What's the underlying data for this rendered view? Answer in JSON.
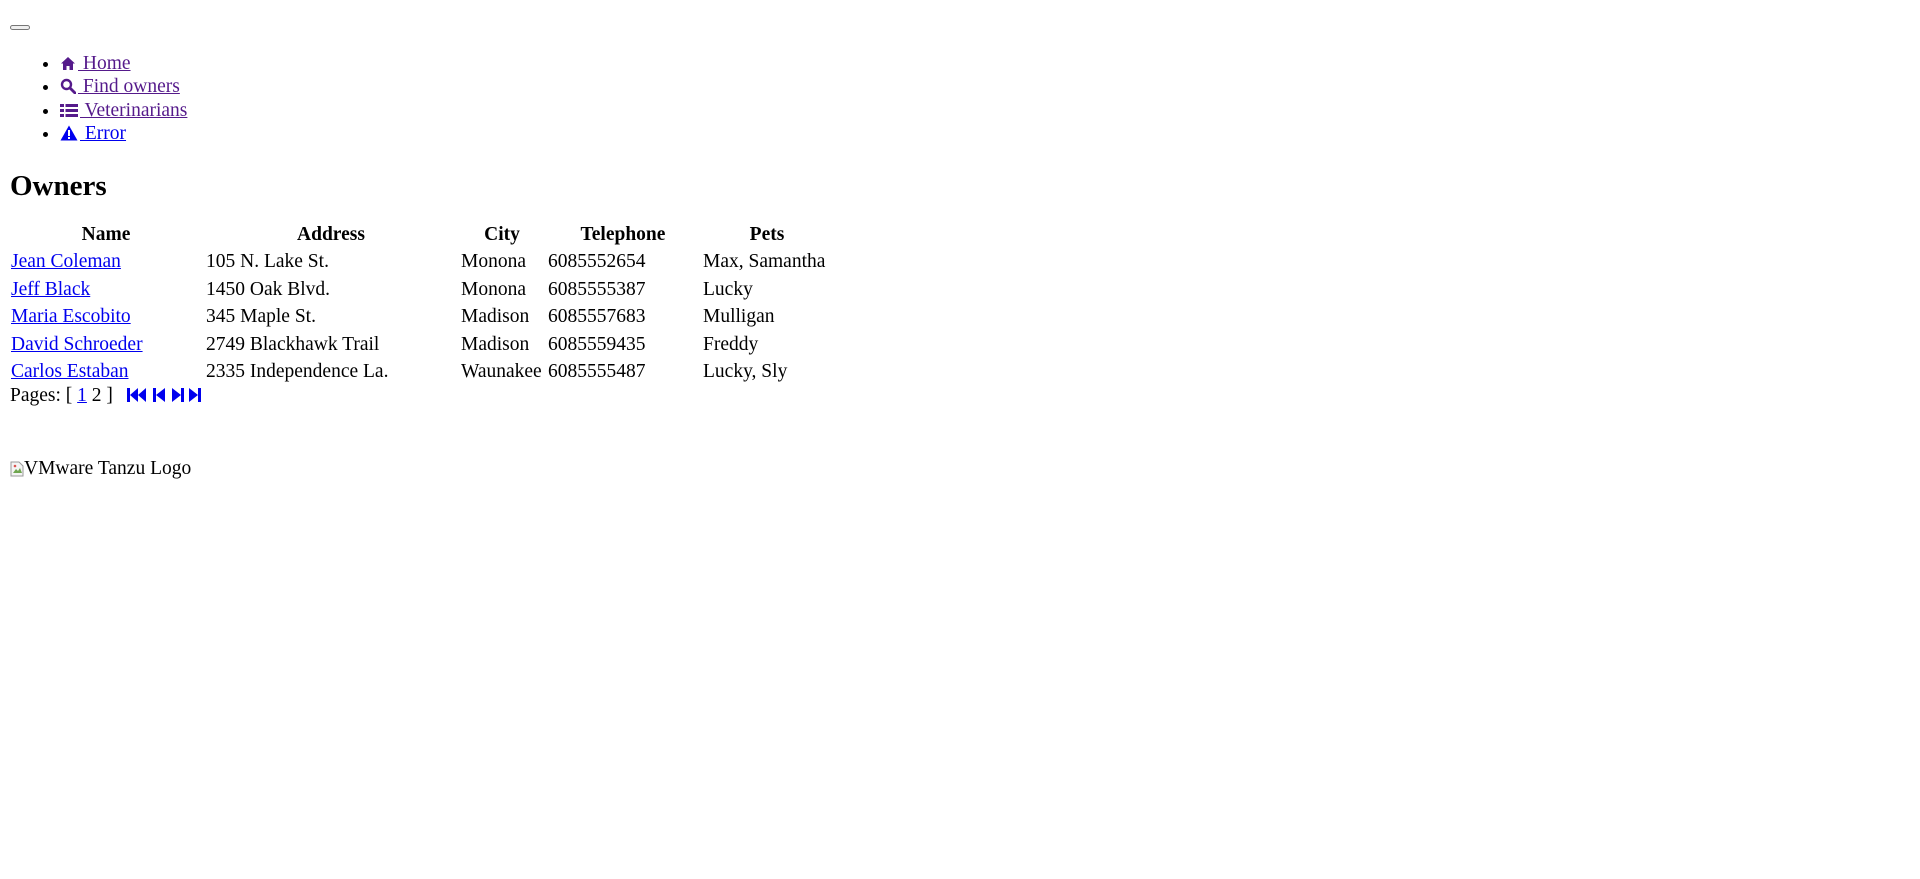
{
  "nav": {
    "toggle_label": "",
    "items": [
      {
        "label": " Home",
        "icon": "home-icon"
      },
      {
        "label": " Find owners",
        "icon": "search-icon"
      },
      {
        "label": " Veterinarians",
        "icon": "list-icon"
      },
      {
        "label": " Error",
        "icon": "warning-icon"
      }
    ]
  },
  "page_title": "Owners",
  "table": {
    "headers": [
      "Name",
      "Address",
      "City",
      "Telephone",
      "Pets"
    ],
    "rows": [
      {
        "name": "Jean Coleman",
        "address": "105 N. Lake St.",
        "city": "Monona",
        "telephone": "6085552654",
        "pets": "Max, Samantha"
      },
      {
        "name": "Jeff Black",
        "address": "1450 Oak Blvd.",
        "city": "Monona",
        "telephone": "6085555387",
        "pets": "Lucky"
      },
      {
        "name": "Maria Escobito",
        "address": "345 Maple St.",
        "city": "Madison",
        "telephone": "6085557683",
        "pets": "Mulligan"
      },
      {
        "name": "David Schroeder",
        "address": "2749 Blackhawk Trail",
        "city": "Madison",
        "telephone": "6085559435",
        "pets": "Freddy"
      },
      {
        "name": "Carlos Estaban",
        "address": "2335 Independence La.",
        "city": "Waunakee",
        "telephone": "6085555487",
        "pets": "Lucky, Sly"
      }
    ]
  },
  "pagination": {
    "prefix": "Pages: [",
    "page1": "1",
    "page2": "2",
    "suffix": "]",
    "icons": [
      "first-page-icon",
      "previous-page-icon",
      "next-page-icon",
      "last-page-icon"
    ]
  },
  "footer": {
    "logo_alt": "VMware Tanzu Logo"
  },
  "colors": {
    "link": "#0000ee",
    "visited_link": "#551a8b"
  }
}
